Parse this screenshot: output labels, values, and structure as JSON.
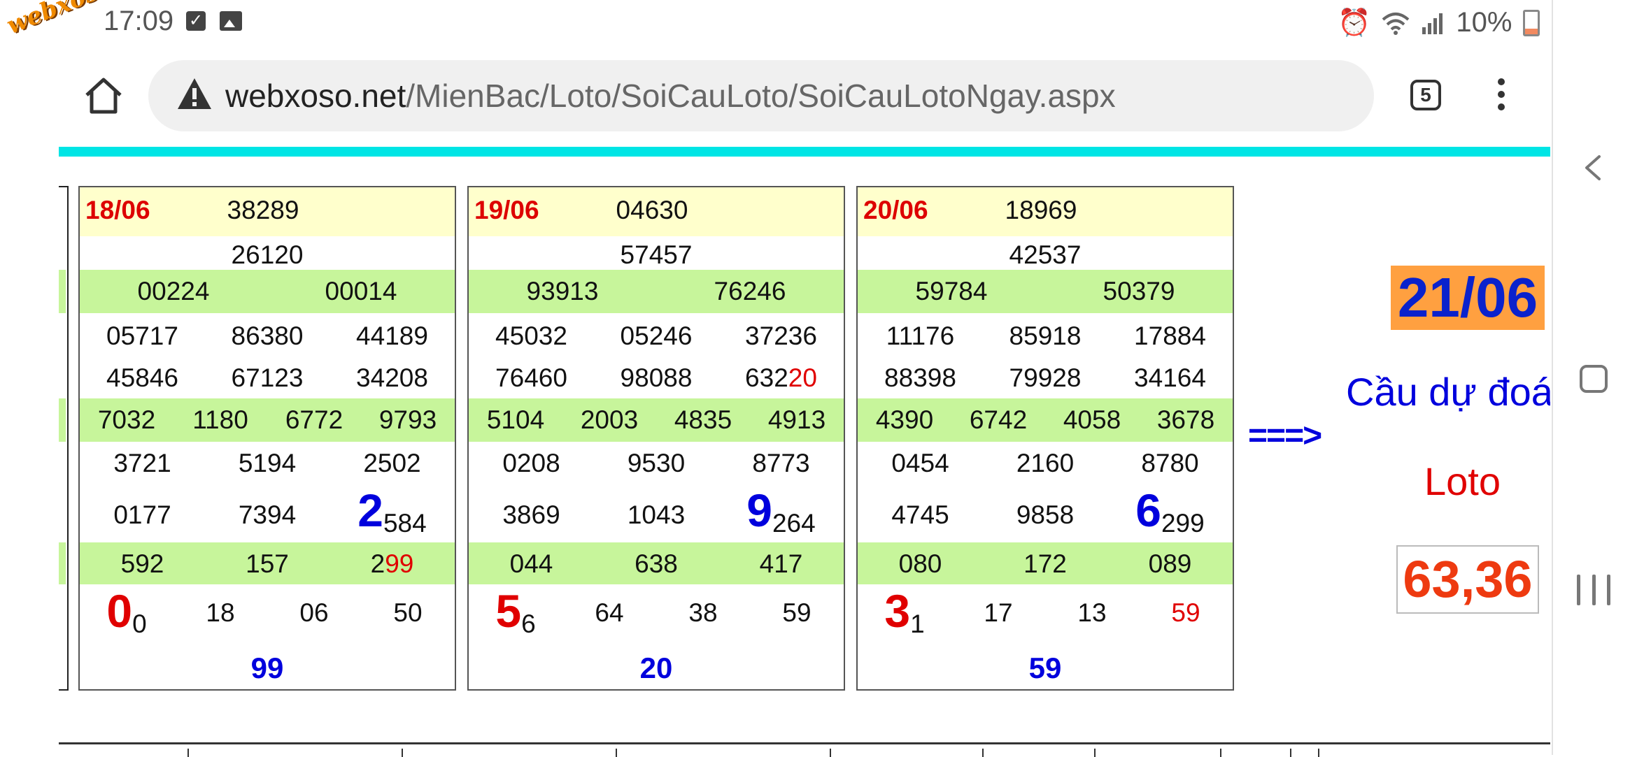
{
  "status_bar": {
    "time": "17:09",
    "battery": "10%",
    "watermark": "webxoso.net"
  },
  "browser": {
    "url_domain": "webxoso.net",
    "url_path": "/MienBac/Loto/SoiCauLoto/SoiCauLotoNgay.aspx",
    "tab_count": "5"
  },
  "panels": [
    {
      "date": "18/06",
      "db": "38289",
      "g1": "26120",
      "g2": [
        "00224",
        "00014"
      ],
      "g3a": [
        "05717",
        "86380",
        "44189"
      ],
      "g3b": [
        "45846",
        "67123",
        "34208"
      ],
      "g4": [
        "7032",
        "1180",
        "6772",
        "9793"
      ],
      "g5a": [
        "3721",
        "5194",
        "2502"
      ],
      "g5b": [
        "0177",
        "7394"
      ],
      "g5b_hl_big": "2",
      "g5b_hl_rest": "584",
      "g6": [
        "592",
        "157"
      ],
      "g6_last_pre": "2",
      "g6_last_red": "99",
      "g7_big": "0",
      "g7_small": "0",
      "g7": [
        "18",
        "06",
        "50"
      ],
      "g7_last_red": false,
      "result": "99"
    },
    {
      "date": "19/06",
      "db": "04630",
      "g1": "57457",
      "g2": [
        "93913",
        "76246"
      ],
      "g3a": [
        "45032",
        "05246",
        "37236"
      ],
      "g3b_plain": [
        "76460",
        "98088"
      ],
      "g3b_last_pre": "632",
      "g3b_last_red": "20",
      "g4": [
        "5104",
        "2003",
        "4835",
        "4913"
      ],
      "g5a": [
        "0208",
        "9530",
        "8773"
      ],
      "g5b": [
        "3869",
        "1043"
      ],
      "g5b_hl_big": "9",
      "g5b_hl_rest": "264",
      "g6": [
        "044",
        "638",
        "417"
      ],
      "g7_big": "5",
      "g7_small": "6",
      "g7": [
        "64",
        "38",
        "59"
      ],
      "result": "20"
    },
    {
      "date": "20/06",
      "db": "18969",
      "g1": "42537",
      "g2": [
        "59784",
        "50379"
      ],
      "g3a": [
        "11176",
        "85918",
        "17884"
      ],
      "g3b": [
        "88398",
        "79928",
        "34164"
      ],
      "g4": [
        "4390",
        "6742",
        "4058",
        "3678"
      ],
      "g5a": [
        "0454",
        "2160",
        "8780"
      ],
      "g5b": [
        "4745",
        "9858"
      ],
      "g5b_hl_big": "6",
      "g5b_hl_rest": "299",
      "g6": [
        "080",
        "172",
        "089"
      ],
      "g7_big": "3",
      "g7_small": "1",
      "g7": [
        "17",
        "13"
      ],
      "g7_last_red": "59",
      "result": "59"
    }
  ],
  "arrow": "===>",
  "prediction": {
    "date": "21/06",
    "title": "Cầu dự đoá",
    "label": "Loto",
    "value": "63,36"
  },
  "colors": {
    "accent_line": "#00e5e5",
    "band_green": "#c7f59b",
    "band_yellow": "#ffffcc",
    "date_red": "#dd0000",
    "highlight_blue": "#0000dd",
    "prediction_orange": "#ffa040"
  }
}
